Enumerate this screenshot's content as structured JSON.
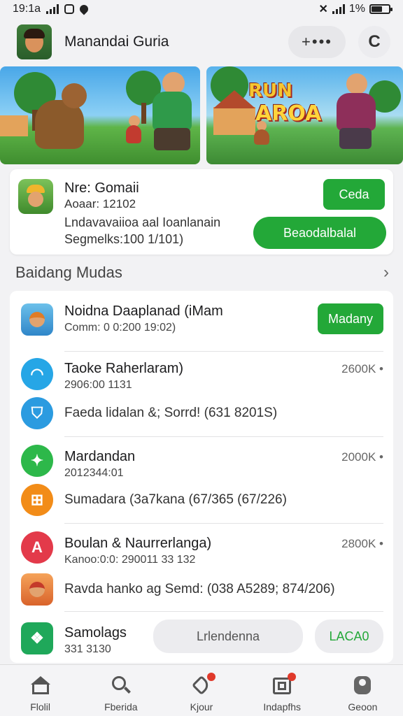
{
  "status_bar": {
    "time": "19:1a",
    "battery": "1%"
  },
  "header": {
    "title": "Manandai Guria",
    "more_label": "+•••",
    "refresh_label": "C"
  },
  "banners": [
    {
      "logo_line1": "RUN",
      "logo_line2": "AROA"
    }
  ],
  "featured": {
    "name": "Nre: Gomaii",
    "subtitle": "Aoaar: 12102",
    "description_line1": "Lndavavaiioa aal Ioanlanain",
    "description_line2": "Segmelks:100 1/101)",
    "button_primary": "Ceda",
    "button_secondary": "Beaodalbalal"
  },
  "section": {
    "title": "Baidang Mudas",
    "chevron": "›"
  },
  "list": [
    {
      "name": "Noidna Daaplanad (iMam",
      "sub": "Comm: 0 0:200 19:02)",
      "button": "Madany"
    },
    {
      "name": "Taoke Raherlaram)",
      "sub": "2906:00 1131",
      "size": "2600K",
      "line": "Faeda lidalan &; Sorrd! (631 8201S)"
    },
    {
      "name": "Mardandan",
      "sub": "2012344:01",
      "size": "2000K",
      "line": "Sumadara (3a7kana (67/365 (67/226)"
    },
    {
      "name": "Boulan & Naurrerlanga)",
      "sub": "Kanoo:0:0: 290011 33 132",
      "size": "2800K",
      "line": "Ravda hanko ag Semd: (038 A5289; 874/206)"
    },
    {
      "name": "Samolags",
      "sub": "331 3130",
      "input_placeholder": "Lrlendenna",
      "action_label": "LACA0"
    }
  ],
  "nav": [
    {
      "label": "Flolil",
      "icon": "home-icon"
    },
    {
      "label": "Fberida",
      "icon": "search-icon"
    },
    {
      "label": "Kjour",
      "icon": "tag-icon"
    },
    {
      "label": "Indapfhs",
      "icon": "updates-icon"
    },
    {
      "label": "Geoon",
      "icon": "account-icon"
    }
  ],
  "colors": {
    "accent_green": "#23a838",
    "badge_red": "#e0392b"
  }
}
